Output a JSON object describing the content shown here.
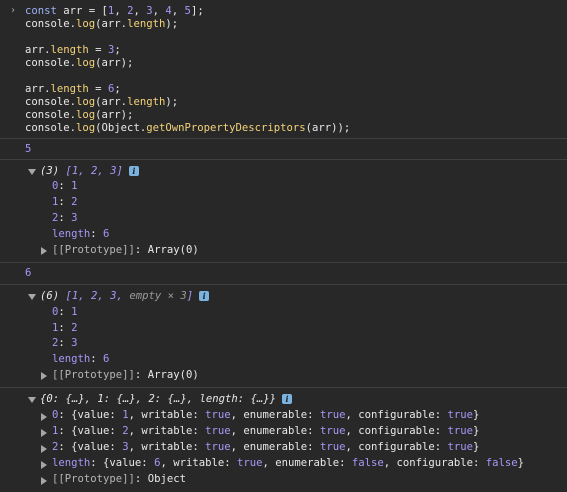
{
  "code": {
    "line1": {
      "kw": "const",
      "var": " arr = [",
      "n1": "1",
      "s1": ", ",
      "n2": "2",
      "s2": ", ",
      "n3": "3",
      "s3": ", ",
      "n4": "4",
      "s4": ", ",
      "n5": "5",
      "end": "];"
    },
    "line2": {
      "a": "console.",
      "fn": "log",
      "b": "(arr.",
      "prop": "length",
      "c": ");"
    },
    "line3": {
      "a": "arr.",
      "prop": "length",
      "b": " = ",
      "n": "3",
      "c": ";"
    },
    "line4": {
      "a": "console.",
      "fn": "log",
      "b": "(arr);"
    },
    "line5": {
      "a": "arr.",
      "prop": "length",
      "b": " = ",
      "n": "6",
      "c": ";"
    },
    "line6": {
      "a": "console.",
      "fn": "log",
      "b": "(arr.",
      "prop": "length",
      "c": ");"
    },
    "line7": {
      "a": "console.",
      "fn": "log",
      "b": "(arr);"
    },
    "line8": {
      "a": "console.",
      "fn": "log",
      "b": "(Object.",
      "fn2": "getOwnPropertyDescriptors",
      "c": "(arr));"
    }
  },
  "output1": {
    "value": "5"
  },
  "array3": {
    "header_count": "(3)",
    "header_items": "[1, 2, 3]",
    "info": "i",
    "entries": [
      {
        "key": "0",
        "value": "1"
      },
      {
        "key": "1",
        "value": "2"
      },
      {
        "key": "2",
        "value": "3"
      }
    ],
    "length_key": "length",
    "length_value": "6",
    "proto_key": "[[Prototype]]",
    "proto_value": "Array(0)"
  },
  "output2": {
    "value": "6"
  },
  "array6": {
    "header_count": "(6)",
    "header_items_a": "[1, 2, 3, ",
    "header_empty": "empty × 3",
    "header_items_b": "]",
    "info": "i",
    "entries": [
      {
        "key": "0",
        "value": "1"
      },
      {
        "key": "1",
        "value": "2"
      },
      {
        "key": "2",
        "value": "3"
      }
    ],
    "length_key": "length",
    "length_value": "6",
    "proto_key": "[[Prototype]]",
    "proto_value": "Array(0)"
  },
  "descriptors": {
    "header": "{0: {…}, 1: {…}, 2: {…}, length: {…}}",
    "info": "i",
    "rows": [
      {
        "key": "0",
        "value": "1",
        "writable": "true",
        "enumerable": "true",
        "configurable": "true"
      },
      {
        "key": "1",
        "value": "2",
        "writable": "true",
        "enumerable": "true",
        "configurable": "true"
      },
      {
        "key": "2",
        "value": "3",
        "writable": "true",
        "enumerable": "true",
        "configurable": "true"
      },
      {
        "key": "length",
        "value": "6",
        "writable": "true",
        "enumerable": "false",
        "configurable": "false"
      }
    ],
    "labels": {
      "value": "value",
      "writable": "writable",
      "enumerable": "enumerable",
      "configurable": "configurable"
    },
    "proto_key": "[[Prototype]]",
    "proto_value": "Object"
  }
}
